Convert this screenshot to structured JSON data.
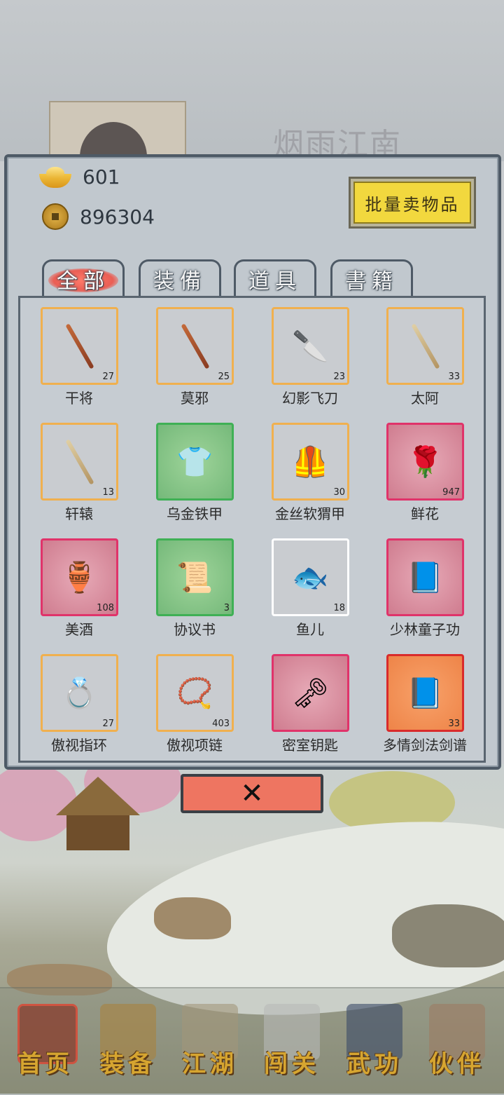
{
  "background": {
    "title": "烟雨江南"
  },
  "currency": {
    "ingot": "601",
    "coins": "896304"
  },
  "sell_button": "批量卖物品",
  "tabs": [
    {
      "label": "全部",
      "active": true
    },
    {
      "label": "装備"
    },
    {
      "label": "道具"
    },
    {
      "label": "書籍"
    }
  ],
  "items": [
    {
      "name": "干将",
      "count": "27",
      "rarity": "orange",
      "icon": "sword-icon"
    },
    {
      "name": "莫邪",
      "count": "25",
      "rarity": "orange",
      "icon": "sword-icon"
    },
    {
      "name": "幻影飞刀",
      "count": "23",
      "rarity": "orange",
      "icon": "flying-dagger-icon"
    },
    {
      "name": "太阿",
      "count": "33",
      "rarity": "orange",
      "icon": "sword-icon"
    },
    {
      "name": "轩辕",
      "count": "13",
      "rarity": "orange",
      "icon": "sword-icon"
    },
    {
      "name": "乌金铁甲",
      "count": "",
      "rarity": "green",
      "icon": "armor-icon"
    },
    {
      "name": "金丝软猬甲",
      "count": "30",
      "rarity": "orange",
      "icon": "vest-icon"
    },
    {
      "name": "鲜花",
      "count": "947",
      "rarity": "red",
      "icon": "flower-icon"
    },
    {
      "name": "美酒",
      "count": "108",
      "rarity": "red",
      "icon": "wine-jar-icon"
    },
    {
      "name": "协议书",
      "count": "3",
      "rarity": "green",
      "icon": "contract-icon"
    },
    {
      "name": "鱼儿",
      "count": "18",
      "rarity": "white",
      "icon": "fish-icon"
    },
    {
      "name": "少林童子功",
      "count": "",
      "rarity": "red",
      "icon": "book-icon"
    },
    {
      "name": "傲视指环",
      "count": "27",
      "rarity": "orange",
      "icon": "ring-icon"
    },
    {
      "name": "傲视项链",
      "count": "403",
      "rarity": "orange",
      "icon": "necklace-icon"
    },
    {
      "name": "密室钥匙",
      "count": "",
      "rarity": "red",
      "icon": "key-icon"
    },
    {
      "name": "多情剑法剑谱",
      "count": "33",
      "rarity": "redorange",
      "icon": "book-icon"
    }
  ],
  "close_button": "✕",
  "nav": [
    {
      "label": "首页",
      "icon": "home-icon",
      "active": true
    },
    {
      "label": "装备",
      "icon": "armor-icon"
    },
    {
      "label": "江湖",
      "icon": "scroll-icon"
    },
    {
      "label": "闯关",
      "icon": "battle-icon"
    },
    {
      "label": "武功",
      "icon": "martial-book-icon"
    },
    {
      "label": "伙伴",
      "icon": "partners-icon"
    }
  ]
}
